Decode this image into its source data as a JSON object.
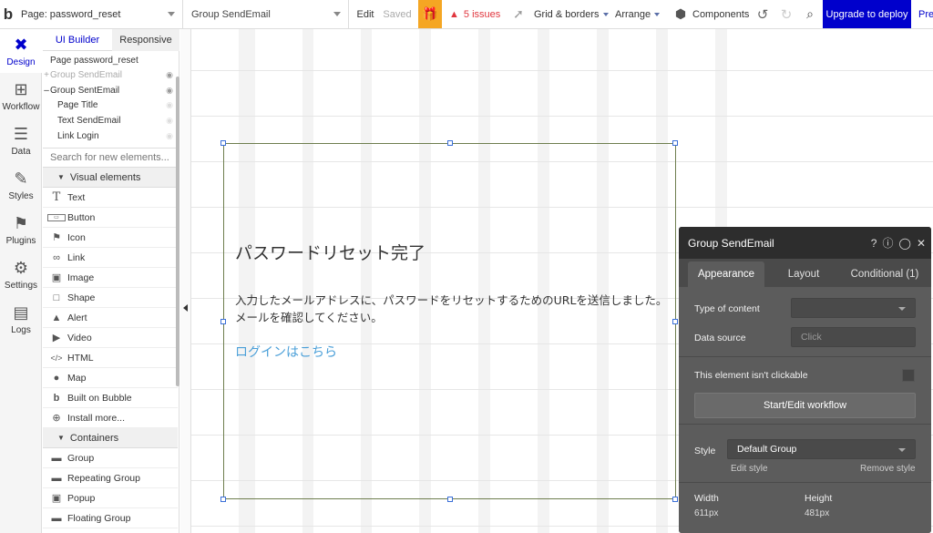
{
  "topbar": {
    "logo": "b",
    "page_select": "Page: password_reset",
    "element_select": "Group SendEmail",
    "edit": "Edit",
    "saved": "Saved",
    "issues": "5 issues",
    "grid_borders": "Grid & borders",
    "arrange": "Arrange",
    "components": "Components",
    "upgrade": "Upgrade to deploy",
    "preview": "Pre"
  },
  "rail": {
    "items": [
      {
        "label": "Design",
        "icon": "design-icon"
      },
      {
        "label": "Workflow",
        "icon": "workflow-icon"
      },
      {
        "label": "Data",
        "icon": "data-icon"
      },
      {
        "label": "Styles",
        "icon": "styles-icon"
      },
      {
        "label": "Plugins",
        "icon": "plugins-icon"
      },
      {
        "label": "Settings",
        "icon": "settings-icon"
      },
      {
        "label": "Logs",
        "icon": "logs-icon"
      }
    ]
  },
  "tree": {
    "tabs": [
      "UI Builder",
      "Responsive"
    ],
    "elements": [
      {
        "label": "Page password_reset"
      },
      {
        "label": "Group SendEmail"
      },
      {
        "label": "Group SentEmail"
      },
      {
        "label": "Page Title"
      },
      {
        "label": "Text SendEmail"
      },
      {
        "label": "Link Login"
      }
    ],
    "search_placeholder": "Search for new elements...",
    "visual_header": "Visual elements",
    "visual_items": [
      "Text",
      "Button",
      "Icon",
      "Link",
      "Image",
      "Shape",
      "Alert",
      "Video",
      "HTML",
      "Map",
      "Built on Bubble",
      "Install more..."
    ],
    "containers_header": "Containers",
    "container_items": [
      "Group",
      "Repeating Group",
      "Popup",
      "Floating Group"
    ]
  },
  "canvas": {
    "title": "パスワードリセット完了",
    "body_line1": "入力したメールアドレスに、パスワードをリセットするためのURLを送信しました。",
    "body_line2": "メールを確認してください。",
    "link": "ログインはこちら"
  },
  "props": {
    "title": "Group SendEmail",
    "tabs": [
      "Appearance",
      "Layout",
      "Conditional (1)"
    ],
    "type_of_content_label": "Type of content",
    "data_source_label": "Data source",
    "data_source_placeholder": "Click",
    "not_clickable_label": "This element isn't clickable",
    "workflow_button": "Start/Edit workflow",
    "style_label": "Style",
    "style_value": "Default Group",
    "edit_style": "Edit style",
    "remove_style": "Remove style",
    "width_label": "Width",
    "width_value": "611px",
    "height_label": "Height",
    "height_value": "481px"
  }
}
